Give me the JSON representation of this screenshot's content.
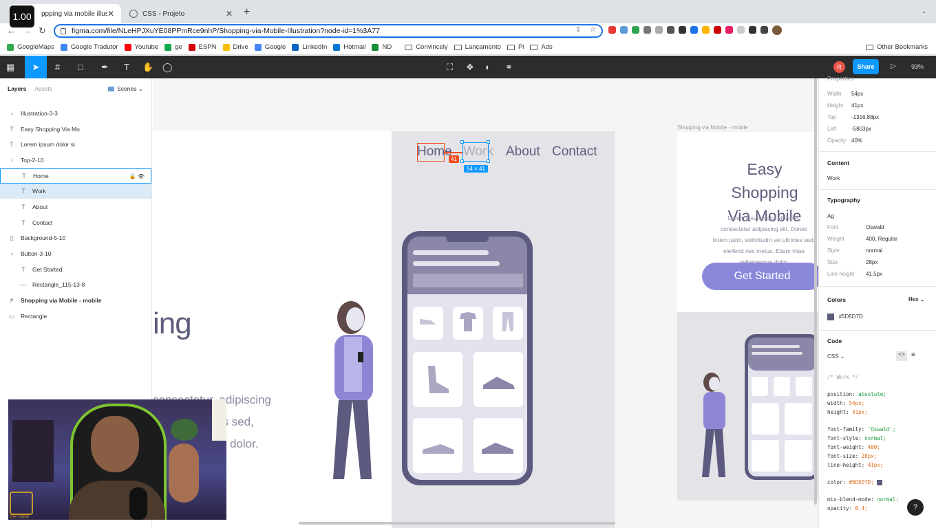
{
  "browser": {
    "zoom_badge": "1.00",
    "tabs": [
      {
        "title": "ppping via mobile illustration"
      },
      {
        "title": "CSS - Projeto"
      }
    ],
    "new_tab": "+",
    "url": "figma.com/file/NLeHPJXuYE08PPmRce9nhP/Shopping-via-Mobile-Illustration?node-id=1%3A77",
    "bookmarks": [
      "GoogleMaps",
      "Google Tradutor",
      "Youtube",
      "ge",
      "ESPN",
      "Drive",
      "Google",
      "LinkedIn",
      "Hotmail",
      "ND",
      "Convincely",
      "Lançamento",
      "Pi",
      "Ads"
    ],
    "bookmark_colors": [
      "#34a853",
      "#4285f4",
      "#ff0000",
      "#0ca84a",
      "#d50000",
      "#fbbc04",
      "#4285f4",
      "#0a66c2",
      "#0078d4",
      "#1a8f3a",
      "#777777",
      "#777777",
      "#777777",
      "#777777"
    ],
    "other_bookmarks": "Other Bookmarks",
    "extension_colors": [
      "#e53935",
      "#5c9bd6",
      "#2ea44f",
      "#777777",
      "#aaaaaa",
      "#555555",
      "#333333",
      "#1a73e8",
      "#ffb300",
      "#cc0000",
      "#e91e63",
      "#cccccc",
      "#333333",
      "#444444"
    ]
  },
  "figma_toolbar": {
    "avatar": "R",
    "share": "Share",
    "zoom": "93%"
  },
  "layers": {
    "tab_layers": "Layers",
    "tab_assets": "Assets",
    "scenes": "Scenes",
    "items": [
      {
        "label": "Illustration-3-3",
        "icon": "▫"
      },
      {
        "label": "Easy Shopping Via Mo",
        "icon": "T"
      },
      {
        "label": "Lorem ipsum dolor si",
        "icon": "T"
      },
      {
        "label": "Top-2-10",
        "icon": "▫"
      },
      {
        "label": "Home",
        "icon": "T"
      },
      {
        "label": "Work",
        "icon": "T"
      },
      {
        "label": "About",
        "icon": "T"
      },
      {
        "label": "Contact",
        "icon": "T"
      },
      {
        "label": "Background-5-10",
        "icon": "▯"
      },
      {
        "label": "Button-3-10",
        "icon": "▫"
      },
      {
        "label": "Get Started",
        "icon": "T"
      },
      {
        "label": "Rectangle_115-13-8",
        "icon": "—"
      },
      {
        "label": "Shopping via Mobile - mobile",
        "icon": "#"
      },
      {
        "label": "Rectangle",
        "icon": "▭"
      }
    ]
  },
  "canvas": {
    "nav": [
      "Home",
      "Work",
      "About",
      "Contact"
    ],
    "distance": "41",
    "size": "54 × 41",
    "big_word": "ing",
    "lorem_lines": [
      "consectetur, adipiscing",
      "es sed,",
      "dolor."
    ],
    "right_frame_label": "Shopping via Mobile - mobile",
    "right_title": "Easy Shopping Via Mobile",
    "right_lorem": "Lorem ipsum dolor sit amet, consectetur adipiscing elit. Donec lorem justo, sollicitudin vel ultricies sed, eleifend nec metus. Etiam vitae pellentesque dolor.",
    "right_button": "Get Started",
    "colors": {
      "text": "#5D5D7D",
      "accent": "#8b88dc",
      "frame_bg": "#e3e3e8"
    }
  },
  "props": {
    "header": "Properties",
    "width_k": "Width",
    "width_v": "54px",
    "height_k": "Height",
    "height_v": "41px",
    "top_k": "Top",
    "top_v": "-1316.88px",
    "left_k": "Left",
    "left_v": "-5803px",
    "opacity_k": "Opacity",
    "opacity_v": "40%",
    "content_h": "Content",
    "content_v": "Work",
    "typo_h": "Typography",
    "typo_icon": "Ag",
    "font_k": "Font",
    "font_v": "Oswald",
    "weight_k": "Weight",
    "weight_v": "400, Regular",
    "style_k": "Style",
    "style_v": "normal",
    "size_k": "Size",
    "size_v": "28px",
    "lh_k": "Line height",
    "lh_v": "41.5px",
    "colors_h": "Colors",
    "colors_fmt": "Hex",
    "color_v": "#5D5D7D",
    "code_h": "Code",
    "code_lang": "CSS",
    "code": {
      "comment": "/* Work */",
      "position": "position:",
      "position_v": "absolute;",
      "width": "width:",
      "width_v": "54px;",
      "height": "height:",
      "height_v": "41px;",
      "ff": "font-family:",
      "ff_v": "'Oswald';",
      "fs": "font-style:",
      "fs_v": "normal;",
      "fw": "font-weight:",
      "fw_v": "400;",
      "fz": "font-size:",
      "fz_v": "28px;",
      "lh": "line-height:",
      "lh_v": "41px;",
      "color": "color:",
      "color_v": "#5D5D7D;",
      "mix": "mix-blend-mode:",
      "mix_v": "normal;",
      "op": "opacity:",
      "op_v": "0.4;"
    },
    "help": "?"
  },
  "webcam": {
    "logo_text": "Dev Clube"
  }
}
